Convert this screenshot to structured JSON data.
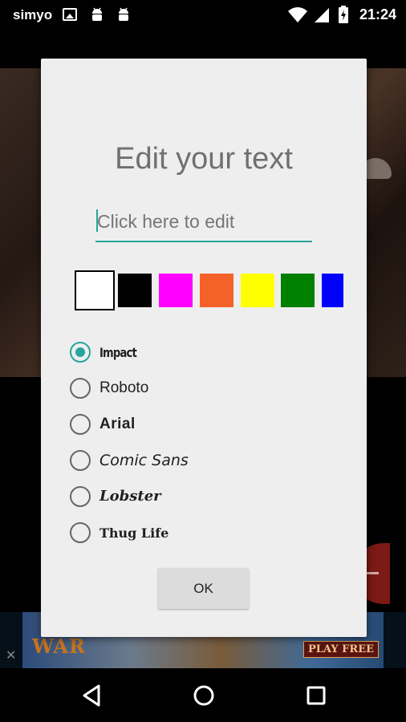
{
  "status_bar": {
    "carrier": "simyo",
    "time": "21:24"
  },
  "dialog": {
    "title": "Edit your text",
    "text_input": {
      "placeholder": "Click here to edit",
      "value": ""
    },
    "colors": [
      {
        "name": "white",
        "hex": "#ffffff",
        "selected": true
      },
      {
        "name": "black",
        "hex": "#000000",
        "selected": false
      },
      {
        "name": "magenta",
        "hex": "#ff00ff",
        "selected": false
      },
      {
        "name": "orange",
        "hex": "#f4622a",
        "selected": false
      },
      {
        "name": "yellow",
        "hex": "#ffff00",
        "selected": false
      },
      {
        "name": "green",
        "hex": "#008000",
        "selected": false
      },
      {
        "name": "blue",
        "hex": "#0000ff",
        "selected": false
      }
    ],
    "fonts": [
      {
        "label": "Impact",
        "checked": true
      },
      {
        "label": "Roboto",
        "checked": false
      },
      {
        "label": "Arial",
        "checked": false
      },
      {
        "label": "Comic Sans",
        "checked": false
      },
      {
        "label": "Lobster",
        "checked": false
      },
      {
        "label": "Thug Life",
        "checked": false
      }
    ],
    "ok_label": "OK"
  },
  "ad_banner": {
    "headline": "WAR",
    "cta": "PLAY FREE",
    "close": "✕"
  },
  "theme": {
    "accent": "#26a69a",
    "dialog_bg": "#eeeeee",
    "title_color": "#707070"
  },
  "navigation": {
    "icons": [
      "back-icon",
      "home-icon",
      "recents-icon"
    ]
  }
}
